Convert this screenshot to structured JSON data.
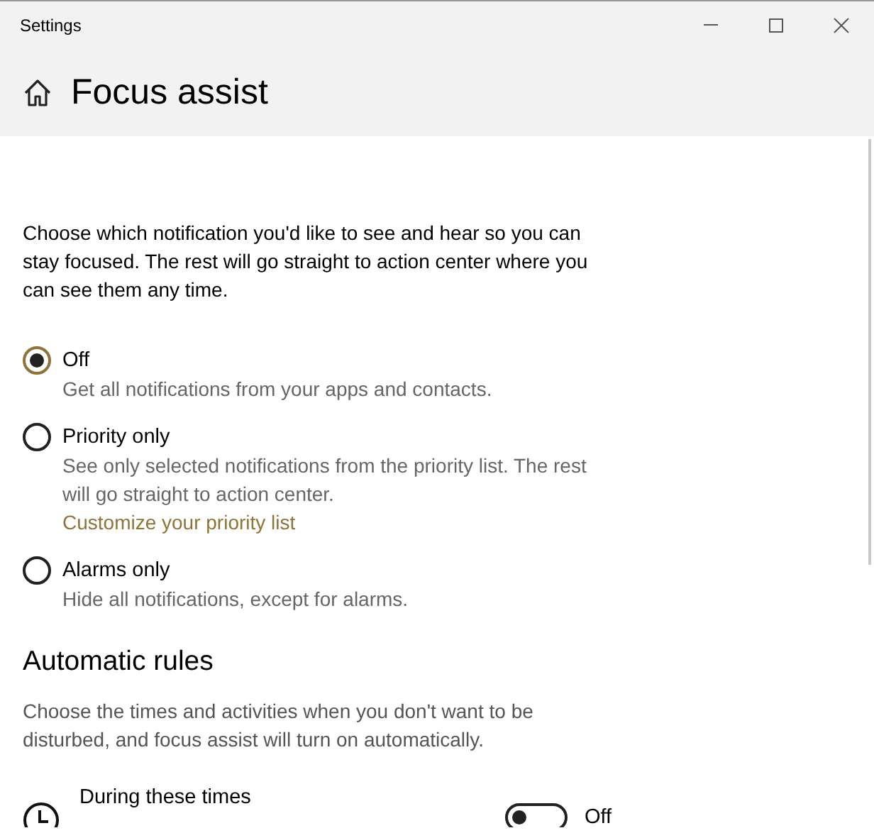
{
  "window": {
    "title": "Settings"
  },
  "page": {
    "title": "Focus assist"
  },
  "intro": "Choose which notification you'd like to see and hear so you can stay focused. The rest will go straight to action center where you can see them any time.",
  "options": [
    {
      "label": "Off",
      "description": "Get all notifications from your apps and contacts.",
      "selected": true
    },
    {
      "label": "Priority only",
      "description": "See only selected notifications from the priority list. The rest will go straight to action center.",
      "link": "Customize your priority list",
      "selected": false
    },
    {
      "label": "Alarms only",
      "description": "Hide all notifications, except for alarms.",
      "selected": false
    }
  ],
  "automatic_rules": {
    "heading": "Automatic rules",
    "description": "Choose the times and activities when you don't want to be disturbed, and focus assist will turn on automatically.",
    "rules": [
      {
        "title": "During these times",
        "on": false,
        "state_label": "Off"
      }
    ]
  }
}
